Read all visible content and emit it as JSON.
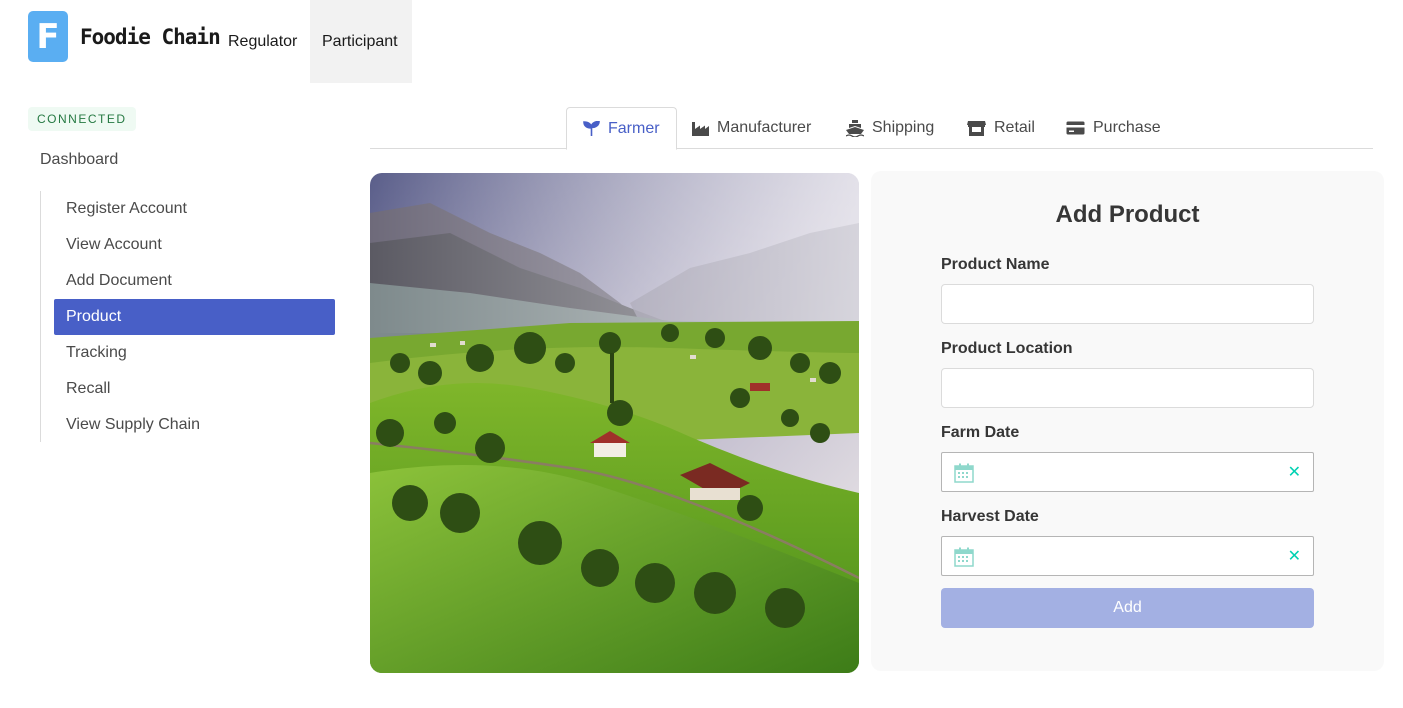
{
  "brand": {
    "logo_letter": "F",
    "name": "Foodie Chain"
  },
  "nav": {
    "items": [
      {
        "label": "Regulator"
      },
      {
        "label": "Participant"
      }
    ],
    "active": "Participant"
  },
  "sidebar": {
    "status_tag": "CONNECTED",
    "dashboard_label": "Dashboard",
    "items": [
      {
        "label": "Register Account"
      },
      {
        "label": "View Account"
      },
      {
        "label": "Add Document"
      },
      {
        "label": "Product"
      },
      {
        "label": "Tracking"
      },
      {
        "label": "Recall"
      },
      {
        "label": "View Supply Chain"
      }
    ],
    "active": "Product"
  },
  "tabs": {
    "items": [
      {
        "label": "Farmer",
        "icon": "seedling-icon"
      },
      {
        "label": "Manufacturer",
        "icon": "industry-icon"
      },
      {
        "label": "Shipping",
        "icon": "ship-icon"
      },
      {
        "label": "Retail",
        "icon": "store-icon"
      },
      {
        "label": "Purchase",
        "icon": "credit-card-icon"
      }
    ],
    "active": "Farmer"
  },
  "form": {
    "title": "Add Product",
    "product_name_label": "Product Name",
    "product_name_value": "",
    "product_location_label": "Product Location",
    "product_location_value": "",
    "farm_date_label": "Farm Date",
    "farm_date_value": "",
    "harvest_date_label": "Harvest Date",
    "harvest_date_value": "",
    "clear_glyph": "✕",
    "submit_label": "Add"
  },
  "colors": {
    "primary": "#485fc7",
    "button_disabled": "#a3b0e3",
    "success_text": "#257942",
    "success_bg": "#effaf3",
    "accent": "#00d1b2",
    "logo": "#5aaef2"
  }
}
